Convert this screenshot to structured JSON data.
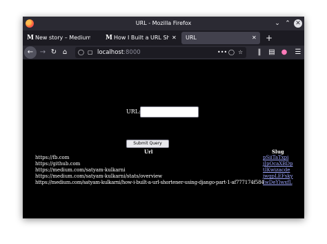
{
  "window": {
    "title": "URL - Mozilla Firefox"
  },
  "tabs": [
    {
      "favicon": "M",
      "label": "New story – Medium",
      "active": false
    },
    {
      "favicon": "M",
      "label": "How I Built a URL Shorte",
      "active": false
    },
    {
      "favicon": "",
      "label": "URL",
      "active": true
    }
  ],
  "navbar": {
    "host": "localhost",
    "port": ":8000",
    "more": "•••"
  },
  "form": {
    "label": "URL:",
    "input_value": "",
    "submit_label": "Submit Query"
  },
  "table": {
    "headers": {
      "url": "Url",
      "slug": "Slug"
    },
    "rows": [
      {
        "url": "https://fb.com",
        "slug": "pSiiTaTxpi"
      },
      {
        "url": "https://github.com",
        "slug": "jJpOcaXBDp"
      },
      {
        "url": "https://medium.com/satyam-kulkarni",
        "slug": "tIKwizacde"
      },
      {
        "url": "https://medium.com/satyam-kulkarni/stats/overview",
        "slug": "jwqpLEFsky"
      },
      {
        "url": "https://medium.com/satyam-kulkarni/how-i-built-a-url-shortener-using-django-part-1-af777174f584",
        "slug": "IwDeYlwxfL"
      }
    ]
  },
  "colors": {
    "titlebar": "#2b2a33",
    "tabstrip": "#1c1b22",
    "content_bg": "#000000",
    "link": "#9ea6ff"
  }
}
